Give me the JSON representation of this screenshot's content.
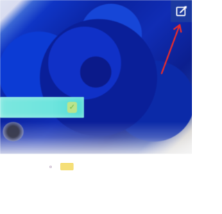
{
  "screen": {
    "background_color": "#ffffff"
  },
  "media": {
    "image_subject_icon": "blue-rose-photo",
    "dominant_color": "#0d28a8"
  },
  "top_right_action": {
    "icon": "edit-icon",
    "annotation_color": "#ea2c2c"
  },
  "overlay": {
    "text": "",
    "icon": "check-icon",
    "background_color": "#6fe5df"
  },
  "details": {
    "meta_text": "",
    "badge_text": "",
    "secondary_text": "",
    "bottom_text": ""
  }
}
